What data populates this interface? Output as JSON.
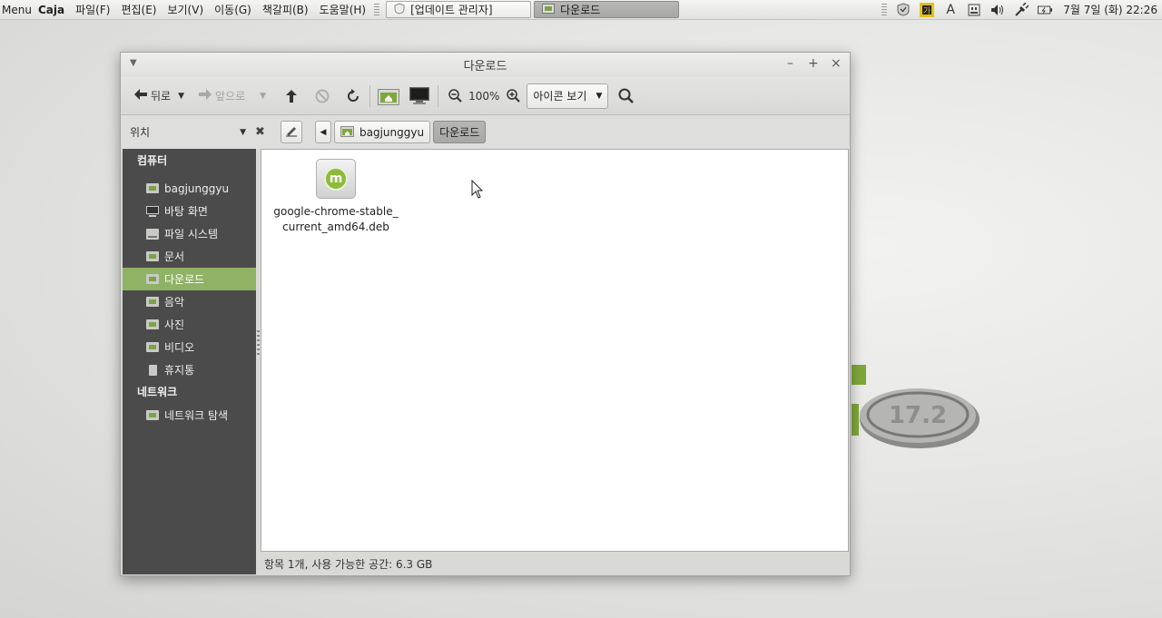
{
  "top_panel": {
    "menu_label": "Menu",
    "app_name": "Caja",
    "app_menus": [
      "파일(F)",
      "편집(E)",
      "보기(V)",
      "이동(G)",
      "책갈피(B)",
      "도움말(H)"
    ],
    "tasks": [
      {
        "label": "[업데이트 관리자]",
        "icon": "shield-icon",
        "active": false
      },
      {
        "label": "다운로드",
        "icon": "folder-icon",
        "active": true
      }
    ],
    "tray_font_label": "A",
    "clock": "7월 7일 (화) 22:26"
  },
  "window": {
    "title": "다운로드",
    "toolbar": {
      "back_label": "뒤로",
      "forward_label": "앞으로",
      "zoom_level": "100%",
      "view_mode": "아이콘 보기"
    },
    "location": {
      "places_label": "위치",
      "path": [
        "bagjunggyu",
        "다운로드"
      ]
    },
    "sidebar": {
      "computer_heading": "컴퓨터",
      "items": [
        {
          "label": "bagjunggyu",
          "icon": "home-folder-icon"
        },
        {
          "label": "바탕 화면",
          "icon": "desktop-icon"
        },
        {
          "label": "파일 시스템",
          "icon": "drive-icon"
        },
        {
          "label": "문서",
          "icon": "documents-folder-icon"
        },
        {
          "label": "다운로드",
          "icon": "downloads-folder-icon",
          "active": true
        },
        {
          "label": "음악",
          "icon": "music-folder-icon"
        },
        {
          "label": "사진",
          "icon": "pictures-folder-icon"
        },
        {
          "label": "비디오",
          "icon": "videos-folder-icon"
        },
        {
          "label": "휴지통",
          "icon": "trash-icon"
        }
      ],
      "network_heading": "네트워크",
      "network_items": [
        {
          "label": "네트워크 탐색",
          "icon": "network-folder-icon"
        }
      ]
    },
    "files": [
      {
        "name": "google-chrome-stable_\ncurrent_amd64.deb",
        "icon": "deb-package-icon"
      }
    ],
    "status": "항목 1개, 사용 가능한 공간: 6.3 GB"
  },
  "colors": {
    "sidebar_bg": "#4b4b4b",
    "sidebar_active": "#8fb264",
    "accent_green": "#8cbb3c"
  }
}
